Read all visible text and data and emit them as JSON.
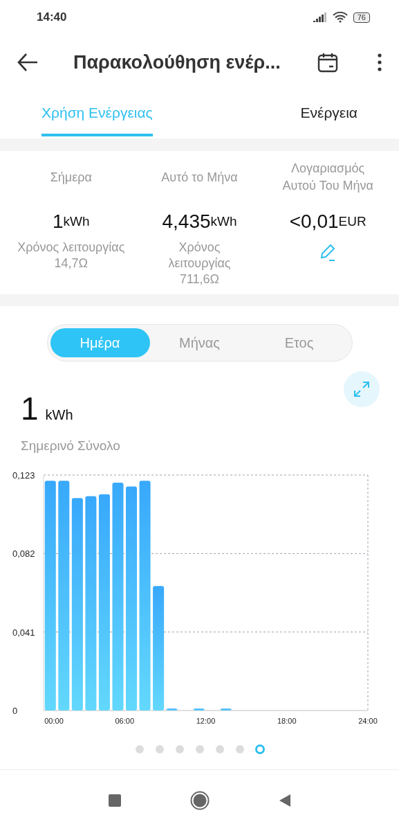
{
  "status_bar": {
    "time": "14:40",
    "battery": "76"
  },
  "header": {
    "title": "Παρακολούθηση ενέρ..."
  },
  "tabs": [
    {
      "label": "Χρήση Ενέργειας",
      "selected": true
    },
    {
      "label": "Ενέργεια",
      "selected": false
    }
  ],
  "stats": [
    {
      "label": "Σήμερα",
      "value": "1",
      "unit": "kWh",
      "footer": "Χρόνος λειτουργίας 14,7Ω",
      "kind": "text"
    },
    {
      "label": "Αυτό το Μήνα",
      "value": "4,435",
      "unit": "kWh",
      "footer": "Χρόνος λειτουργίας 711,6Ω",
      "kind": "text"
    },
    {
      "label": "Λογαριασμός Αυτού Του Μήνα",
      "value": "<0,01",
      "unit": "EUR",
      "kind": "edit"
    }
  ],
  "period_tabs": [
    {
      "label": "Ημέρα",
      "selected": true
    },
    {
      "label": "Μήνας",
      "selected": false
    },
    {
      "label": "Ετος",
      "selected": false
    }
  ],
  "total": {
    "value": "1",
    "unit": "kWh",
    "caption": "Σημερινό Σύνολο"
  },
  "chart": {
    "chart_data": {
      "type": "bar",
      "x": [
        0.5,
        1.5,
        2.5,
        3.5,
        4.5,
        5.5,
        6.5,
        7.5,
        8.5,
        9.5,
        11.5,
        13.5
      ],
      "series": [
        {
          "color": "#38a8fb",
          "values": [
            0.12,
            0.12,
            0.111,
            0.112,
            0.113,
            0.119,
            0.117,
            0.12,
            0.065,
            0.001,
            0.001,
            0.001
          ]
        }
      ],
      "xlim": [
        0,
        24
      ],
      "ylim": [
        0,
        0.123
      ],
      "xticks": [
        {
          "value": 0,
          "label": "00:00"
        },
        {
          "value": 6,
          "label": "06:00"
        },
        {
          "value": 12,
          "label": "12:00"
        },
        {
          "value": 18,
          "label": "18:00"
        },
        {
          "value": 24,
          "label": "24:00"
        }
      ],
      "yticks": [
        {
          "value": 0,
          "label": "0"
        },
        {
          "value": 0.041,
          "label": "0,041"
        },
        {
          "value": 0.082,
          "label": "0,082"
        },
        {
          "value": 0.123,
          "label": "0,123"
        }
      ]
    }
  },
  "page_dots": [
    {
      "selected": false
    },
    {
      "selected": false
    },
    {
      "selected": false
    },
    {
      "selected": false
    },
    {
      "selected": false
    },
    {
      "selected": false
    },
    {
      "selected": true
    }
  ]
}
